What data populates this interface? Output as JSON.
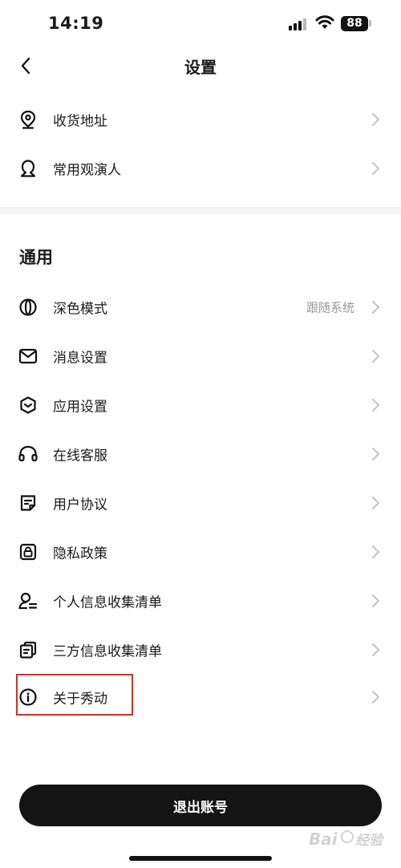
{
  "status": {
    "time": "14:19",
    "battery": "88"
  },
  "nav": {
    "title": "设置"
  },
  "top_list": [
    {
      "label": "收货地址",
      "icon": "location-pin-icon"
    },
    {
      "label": "常用观演人",
      "icon": "person-icon"
    }
  ],
  "general": {
    "title": "通用",
    "items": [
      {
        "label": "深色模式",
        "value": "跟随系统",
        "icon": "dark-mode-icon"
      },
      {
        "label": "消息设置",
        "value": "",
        "icon": "envelope-icon"
      },
      {
        "label": "应用设置",
        "value": "",
        "icon": "app-settings-icon"
      },
      {
        "label": "在线客服",
        "value": "",
        "icon": "headset-icon"
      },
      {
        "label": "用户协议",
        "value": "",
        "icon": "document-icon"
      },
      {
        "label": "隐私政策",
        "value": "",
        "icon": "lock-icon"
      },
      {
        "label": "个人信息收集清单",
        "value": "",
        "icon": "person-list-icon"
      },
      {
        "label": "三方信息收集清单",
        "value": "",
        "icon": "copy-list-icon"
      },
      {
        "label": "关于秀动",
        "value": "",
        "icon": "info-icon"
      }
    ]
  },
  "logout": {
    "label": "退出账号"
  },
  "watermark": {
    "text": "Bai 经验"
  }
}
